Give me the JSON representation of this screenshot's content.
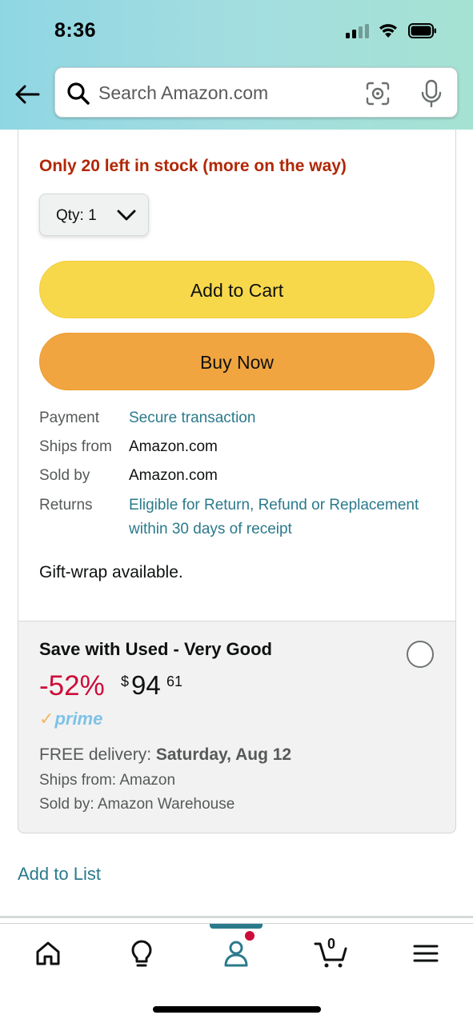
{
  "status_bar": {
    "time": "8:36"
  },
  "search": {
    "placeholder": "Search Amazon.com"
  },
  "product": {
    "stock_message": "Only 20 left in stock (more on the way)",
    "quantity_label": "Qty:",
    "quantity_value": "1",
    "add_to_cart_label": "Add to Cart",
    "buy_now_label": "Buy Now",
    "details": [
      {
        "label": "Payment",
        "value": "Secure transaction"
      },
      {
        "label": "Ships from",
        "value": "Amazon.com"
      },
      {
        "label": "Sold by",
        "value": "Amazon.com"
      },
      {
        "label": "Returns",
        "value_line1": "Eligible for Return, Refund or Replacement",
        "value_line2": "within 30 days of receipt"
      }
    ],
    "gift_wrap": "Gift-wrap available."
  },
  "used_offer": {
    "title": "Save with Used - Very Good",
    "discount": "-52%",
    "price_symbol": "$",
    "price_whole": "94",
    "price_fraction": "61",
    "prime_check": "✓",
    "prime_label": "prime",
    "delivery_prefix": "FREE delivery: ",
    "delivery_date": "Saturday, Aug 12",
    "ships_from": "Ships from: Amazon",
    "sold_by": "Sold by: Amazon Warehouse"
  },
  "add_to_list_label": "Add to List",
  "nav": {
    "items": [
      "home-icon",
      "lightbulb-icon",
      "account-icon",
      "cart-icon",
      "menu-icon"
    ],
    "cart_count": "0",
    "active_color": "#2a7a8c"
  },
  "colors": {
    "stock_red": "#b12704",
    "discount_red": "#cc0c39",
    "link_teal": "#2a7a8c",
    "add_to_cart_yellow": "#f7d84a",
    "buy_now_orange": "#f1a540"
  }
}
